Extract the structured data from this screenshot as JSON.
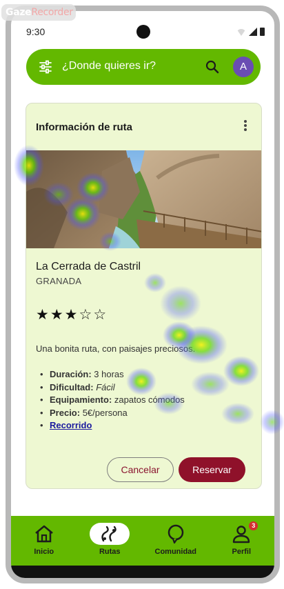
{
  "watermark": {
    "part1": "Gaze",
    "part2": "Recorder"
  },
  "status_bar": {
    "time": "9:30"
  },
  "search": {
    "placeholder": "¿Donde quieres ir?",
    "avatar_initial": "A"
  },
  "card": {
    "title": "Información de ruta",
    "route_name": "La Cerrada de Castril",
    "region": "GRANADA",
    "rating": {
      "value": 3,
      "max": 5
    },
    "description": "Una bonita ruta, con paisajes preciosos.",
    "details": [
      {
        "key": "Duración:",
        "value": "3 horas",
        "style": "normal"
      },
      {
        "key": "Dificultad:",
        "value": "Fácil",
        "style": "italic"
      },
      {
        "key": "Equipamiento:",
        "value": "zapatos cómodos",
        "style": "normal"
      },
      {
        "key": "Precio:",
        "value": "5€/persona",
        "style": "normal"
      }
    ],
    "link_label": "Recorrido",
    "cancel_label": "Cancelar",
    "reserve_label": "Reservar"
  },
  "bottom_nav": {
    "items": [
      {
        "label": "Inicio",
        "icon": "home-icon",
        "active": false
      },
      {
        "label": "Rutas",
        "icon": "route-icon",
        "active": true
      },
      {
        "label": "Comunidad",
        "icon": "chat-bubble-icon",
        "active": false
      },
      {
        "label": "Perfil",
        "icon": "person-icon",
        "active": false,
        "badge": "3"
      }
    ]
  },
  "colors": {
    "primary_green": "#63b800",
    "card_background": "#eef8d2",
    "accent_maroon": "#8f112a",
    "avatar_purple": "#6a4db3"
  }
}
